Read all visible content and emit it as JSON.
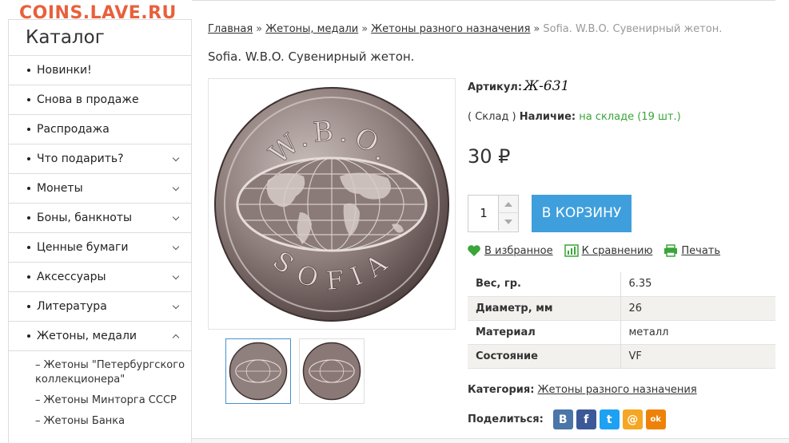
{
  "site": {
    "logo": "COINS.LAVE.RU"
  },
  "sidebar": {
    "title": "Каталог",
    "items": [
      {
        "label": "Новинки!",
        "expandable": false
      },
      {
        "label": "Снова в продаже",
        "expandable": false
      },
      {
        "label": "Распродажа",
        "expandable": false
      },
      {
        "label": "Что подарить?",
        "expandable": true
      },
      {
        "label": "Монеты",
        "expandable": true
      },
      {
        "label": "Боны, банкноты",
        "expandable": true
      },
      {
        "label": "Ценные бумаги",
        "expandable": true
      },
      {
        "label": "Аксессуары",
        "expandable": true
      },
      {
        "label": "Литература",
        "expandable": true
      },
      {
        "label": "Жетоны, медали",
        "expandable": true,
        "expanded": true
      }
    ],
    "sub_items": [
      {
        "label": "Жетоны \"Петербургского коллекционера\""
      },
      {
        "label": "Жетоны Минторга СССР"
      },
      {
        "label": "Жетоны Банка"
      }
    ]
  },
  "breadcrumb": {
    "items": [
      "Главная",
      "Жетоны, медали",
      "Жетоны разного назначения"
    ],
    "separator": "»",
    "current": "Sofia. W.B.O. Сувенирный жетон."
  },
  "product": {
    "title": "Sofia. W.B.O. Сувенирный жетон.",
    "article_label": "Артикул:",
    "article_code": "Ж-631",
    "stock_prefix": "( Склад )",
    "stock_label": "Наличие:",
    "stock_value": "на складе (19 шт.)",
    "price": "30 ₽",
    "quantity": "1",
    "cart_button": "В КОРЗИНУ",
    "coin_top_text": "W.B.O.",
    "coin_bottom_text": "SOFIA"
  },
  "actions": {
    "favorite": "В избранное",
    "compare": "К сравнению",
    "print": "Печать"
  },
  "properties": [
    {
      "key": "Вес, гр.",
      "value": "6.35"
    },
    {
      "key": "Диаметр, мм",
      "value": "26"
    },
    {
      "key": "Материал",
      "value": "металл"
    },
    {
      "key": "Состояние",
      "value": "VF"
    }
  ],
  "category": {
    "label": "Категория:",
    "value": "Жетоны разного назначения"
  },
  "share": {
    "label": "Поделиться:",
    "networks": [
      {
        "name": "vk-icon",
        "glyph": "В",
        "color": "#4a76a8"
      },
      {
        "name": "facebook-icon",
        "glyph": "f",
        "color": "#3b5998"
      },
      {
        "name": "twitter-icon",
        "glyph": "t",
        "color": "#1da1f2"
      },
      {
        "name": "mail-icon",
        "glyph": "@",
        "color": "#f5a623"
      },
      {
        "name": "odnoklassniki-icon",
        "glyph": "ok",
        "color": "#ee8208"
      }
    ]
  },
  "colors": {
    "accent": "#3f9fdc",
    "logo": "#e8603c",
    "in_stock": "#3aa53a",
    "icon_green": "#3aa53a"
  }
}
